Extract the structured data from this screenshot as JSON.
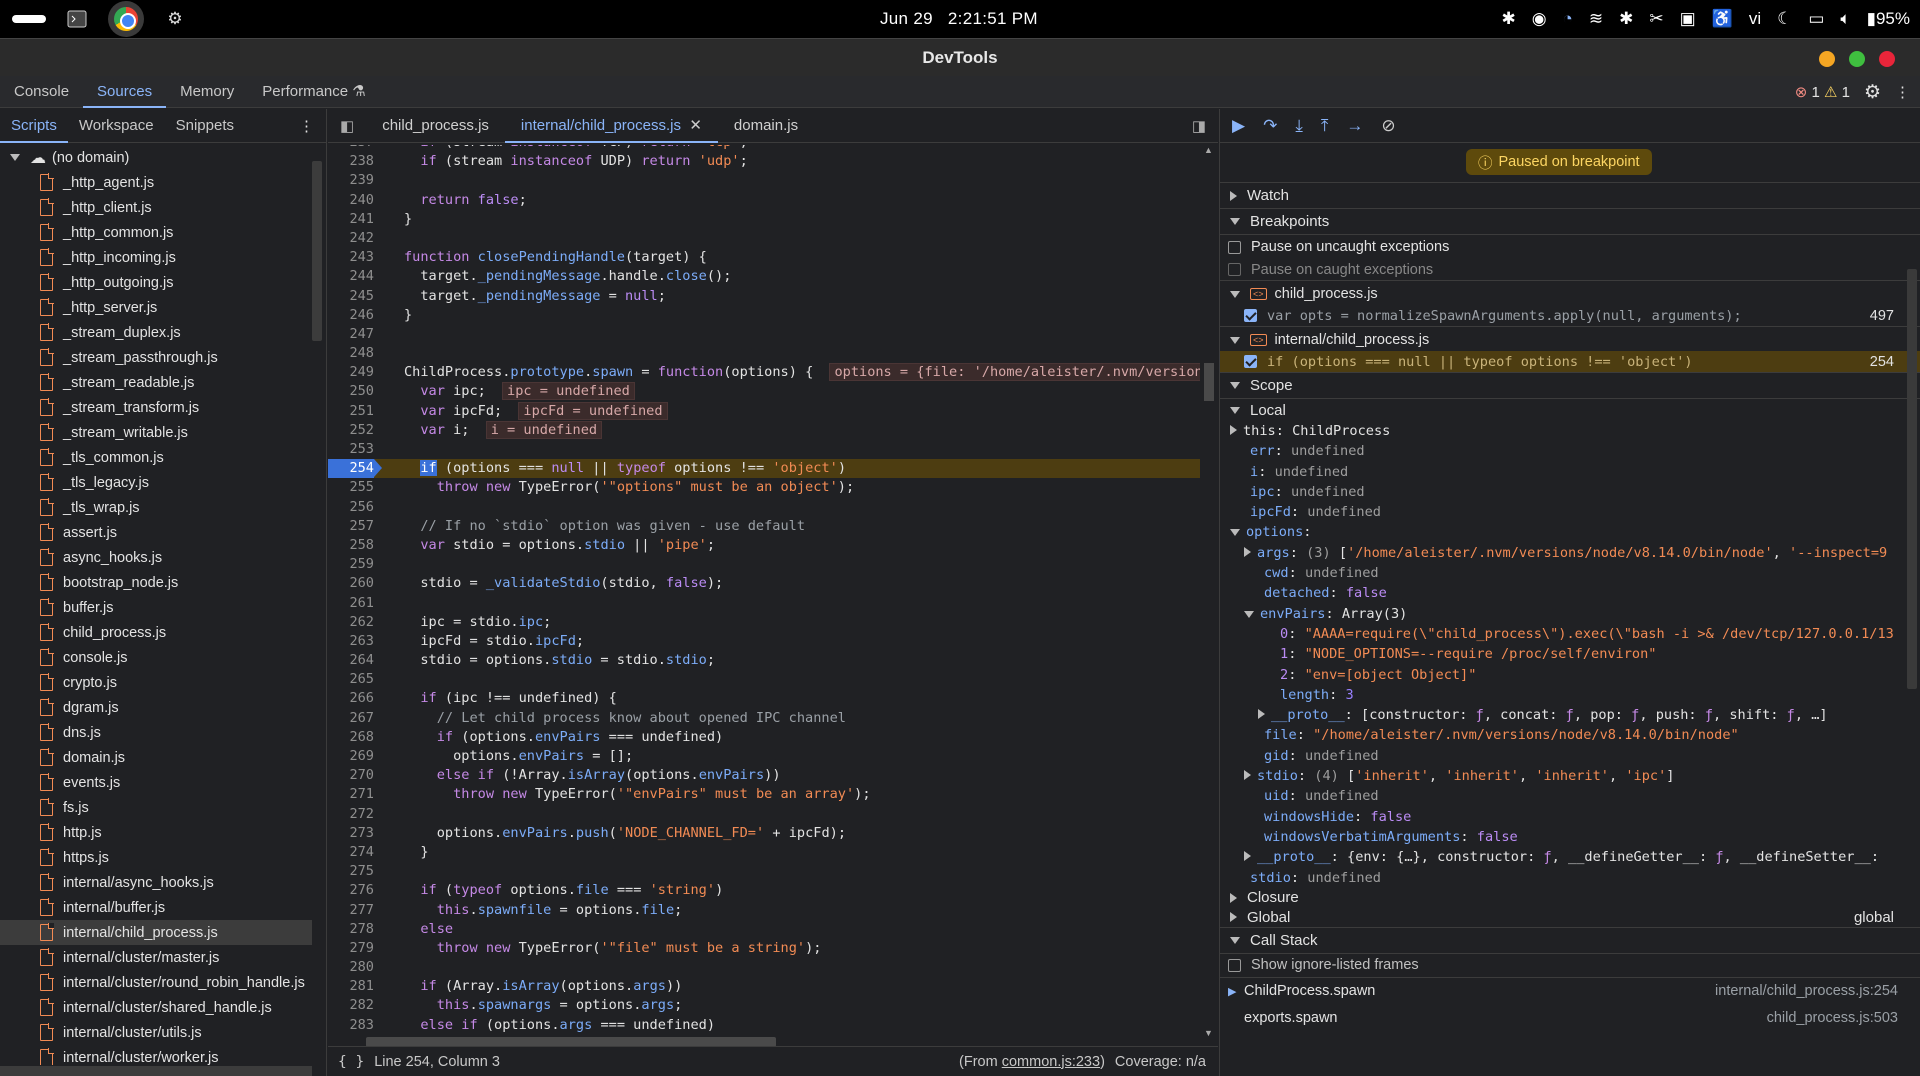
{
  "system_bar": {
    "date": "Jun 29",
    "time": "2:21:51 PM",
    "lang": "vi",
    "battery": "95%"
  },
  "window": {
    "title": "DevTools"
  },
  "panel_tabs": [
    "Console",
    "Sources",
    "Memory",
    "Performance"
  ],
  "issues": {
    "errors": "1",
    "warnings": "1"
  },
  "navigator": {
    "tabs": [
      "Scripts",
      "Workspace",
      "Snippets"
    ],
    "root": "(no domain)",
    "files": [
      "_http_agent.js",
      "_http_client.js",
      "_http_common.js",
      "_http_incoming.js",
      "_http_outgoing.js",
      "_http_server.js",
      "_stream_duplex.js",
      "_stream_passthrough.js",
      "_stream_readable.js",
      "_stream_transform.js",
      "_stream_writable.js",
      "_tls_common.js",
      "_tls_legacy.js",
      "_tls_wrap.js",
      "assert.js",
      "async_hooks.js",
      "bootstrap_node.js",
      "buffer.js",
      "child_process.js",
      "console.js",
      "crypto.js",
      "dgram.js",
      "dns.js",
      "domain.js",
      "events.js",
      "fs.js",
      "http.js",
      "https.js",
      "internal/async_hooks.js",
      "internal/buffer.js",
      "internal/child_process.js",
      "internal/cluster/master.js",
      "internal/cluster/round_robin_handle.js",
      "internal/cluster/shared_handle.js",
      "internal/cluster/utils.js",
      "internal/cluster/worker.js"
    ],
    "selected": "internal/child_process.js"
  },
  "editor": {
    "tabs": [
      "child_process.js",
      "internal/child_process.js",
      "domain.js"
    ],
    "status_left": "Line 254, Column 3",
    "status_from": "(From ",
    "status_from_link": "common.js:233",
    "status_from_end": ")",
    "coverage": "Coverage: n/a"
  },
  "debugger": {
    "paused": "Paused on breakpoint",
    "sections": {
      "watch": "Watch",
      "breakpoints": "Breakpoints",
      "scope": "Scope",
      "local": "Local",
      "closure": "Closure",
      "global": "Global",
      "global_val": "global",
      "callstack": "Call Stack"
    },
    "pause_uncaught": "Pause on uncaught exceptions",
    "pause_caught": "Pause on caught exceptions",
    "bp_files": [
      {
        "file": "child_process.js",
        "code": "var opts = normalizeSpawnArguments.apply(null, arguments);",
        "line": "497"
      },
      {
        "file": "internal/child_process.js",
        "code": "if (options === null || typeof options !== 'object')",
        "line": "254"
      }
    ],
    "show_ignore": "Show ignore-listed frames",
    "frames": [
      {
        "name": "ChildProcess.spawn",
        "loc": "internal/child_process.js:254"
      },
      {
        "name": "exports.spawn",
        "loc": "child_process.js:503"
      }
    ]
  }
}
